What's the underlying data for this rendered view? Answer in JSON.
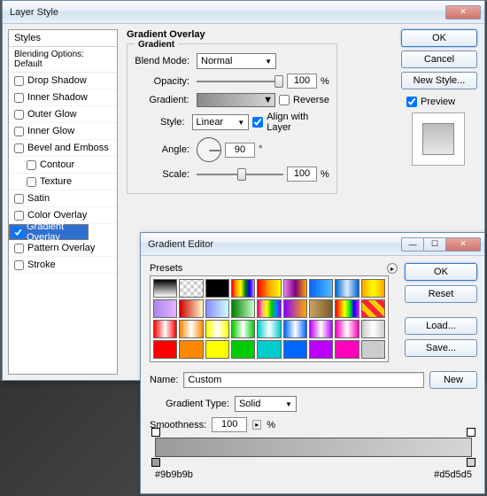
{
  "main": {
    "title": "Layer Style",
    "styles_head": "Styles",
    "styles_sub": "Blending Options: Default",
    "items": [
      {
        "label": "Drop Shadow",
        "checked": false
      },
      {
        "label": "Inner Shadow",
        "checked": false
      },
      {
        "label": "Outer Glow",
        "checked": false
      },
      {
        "label": "Inner Glow",
        "checked": false
      },
      {
        "label": "Bevel and Emboss",
        "checked": false
      },
      {
        "label": "Contour",
        "checked": false,
        "indent": true
      },
      {
        "label": "Texture",
        "checked": false,
        "indent": true
      },
      {
        "label": "Satin",
        "checked": false
      },
      {
        "label": "Color Overlay",
        "checked": false
      },
      {
        "label": "Gradient Overlay",
        "checked": true,
        "selected": true
      },
      {
        "label": "Pattern Overlay",
        "checked": false
      },
      {
        "label": "Stroke",
        "checked": false
      }
    ],
    "section_title": "Gradient Overlay",
    "group_title": "Gradient",
    "blendmode_lbl": "Blend Mode:",
    "blendmode_val": "Normal",
    "opacity_lbl": "Opacity:",
    "opacity_val": "100",
    "pct": "%",
    "gradient_lbl": "Gradient:",
    "reverse_lbl": "Reverse",
    "style_lbl": "Style:",
    "style_val": "Linear",
    "align_lbl": "Align with Layer",
    "angle_lbl": "Angle:",
    "angle_val": "90",
    "deg": "°",
    "scale_lbl": "Scale:",
    "scale_val": "100",
    "ok": "OK",
    "cancel": "Cancel",
    "newstyle": "New Style...",
    "preview_lbl": "Preview"
  },
  "ge": {
    "title": "Gradient Editor",
    "presets_lbl": "Presets",
    "ok": "OK",
    "reset": "Reset",
    "load": "Load...",
    "save": "Save...",
    "name_lbl": "Name:",
    "name_val": "Custom",
    "new": "New",
    "gradtype_lbl": "Gradient Type:",
    "gradtype_val": "Solid",
    "smooth_lbl": "Smoothness:",
    "smooth_val": "100",
    "pct": "%",
    "hex_left": "#9b9b9b",
    "hex_right": "#d5d5d5",
    "swatches": [
      "linear-gradient(#000,#fff)",
      "repeating-conic-gradient(#ccc 0 25%,#fff 0 50%) 0/8px 8px",
      "linear-gradient(#000,#000)",
      "linear-gradient(90deg,red,orange,yellow,green,blue,violet)",
      "linear-gradient(90deg,red,orange,yellow)",
      "linear-gradient(90deg,violet,purple,orange)",
      "linear-gradient(90deg,#06f,#5bf)",
      "linear-gradient(90deg,#06c,#def,#06c)",
      "linear-gradient(90deg,orange,yellow,orange)",
      "linear-gradient(90deg,#a8e,#e5b3ff)",
      "linear-gradient(90deg,#c00,#ffc)",
      "linear-gradient(90deg,#8a8aff,#cff)",
      "linear-gradient(90deg,#007f00,#cfffcf)",
      "linear-gradient(90deg,#f06,#fa8,#ff0,#0c0,#08f,#80f)",
      "linear-gradient(90deg,#80f,#fa0)",
      "linear-gradient(90deg,#c8a464,#7a5a2a)",
      "linear-gradient(90deg,#f00,#f80,#ff0,#0f0,#00f,#f0f)",
      "repeating-linear-gradient(45deg,#f23 0 6px,#fc0 6px 12px)",
      "linear-gradient(90deg,#f00,#fff,#f00)",
      "linear-gradient(90deg,#f80,#fff,#f80)",
      "linear-gradient(90deg,#ff0,#fff,#ff0)",
      "linear-gradient(90deg,#0c0,#fff,#0c0)",
      "linear-gradient(90deg,#0cc,#fff,#0cc)",
      "linear-gradient(90deg,#06f,#fff,#06f)",
      "linear-gradient(90deg,#b0f,#fff,#b0f)",
      "linear-gradient(90deg,#f0b,#fff,#f0b)",
      "linear-gradient(90deg,#ccc,#fff,#ccc)",
      "linear-gradient(#f00,#f00)",
      "linear-gradient(#f80,#f80)",
      "linear-gradient(#ff0,#ff0)",
      "linear-gradient(#0c0,#0c0)",
      "linear-gradient(#0cc,#0cc)",
      "linear-gradient(#06f,#06f)",
      "linear-gradient(#b0f,#b0f)",
      "linear-gradient(#f0b,#f0b)",
      "linear-gradient(#ccc,#ccc)"
    ]
  }
}
